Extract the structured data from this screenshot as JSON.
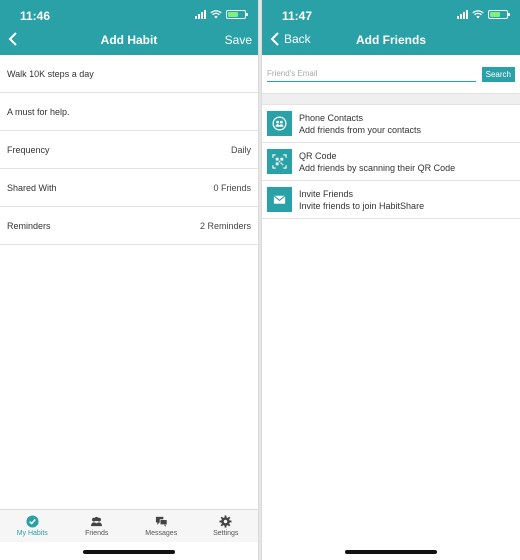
{
  "left": {
    "time": "11:46",
    "nav": {
      "title": "Add Habit",
      "save_label": "Save"
    },
    "rows": [
      {
        "label": "Walk 10K steps a day",
        "value": ""
      },
      {
        "label": "A must for help.",
        "value": ""
      },
      {
        "label": "Frequency",
        "value": "Daily"
      },
      {
        "label": "Shared With",
        "value": "0 Friends"
      },
      {
        "label": "Reminders",
        "value": "2 Reminders"
      }
    ],
    "tabs": [
      {
        "label": "My Habits",
        "icon": "check-circle-icon",
        "active": true
      },
      {
        "label": "Friends",
        "icon": "people-icon",
        "active": false
      },
      {
        "label": "Messages",
        "icon": "chat-icon",
        "active": false
      },
      {
        "label": "Settings",
        "icon": "gear-icon",
        "active": false
      }
    ]
  },
  "right": {
    "time": "11:47",
    "nav": {
      "back_label": "Back",
      "title": "Add Friends"
    },
    "search": {
      "placeholder": "Friend's Email",
      "value": "",
      "button_label": "Search"
    },
    "options": [
      {
        "title": "Phone Contacts",
        "subtitle": "Add friends from your contacts",
        "icon": "contacts-icon"
      },
      {
        "title": "QR Code",
        "subtitle": "Add friends by scanning their QR Code",
        "icon": "qr-code-icon"
      },
      {
        "title": "Invite Friends",
        "subtitle": "Invite friends to join HabitShare",
        "icon": "envelope-icon"
      }
    ]
  },
  "colors": {
    "accent": "#2aa0a7",
    "battery": "#7ef07e"
  }
}
